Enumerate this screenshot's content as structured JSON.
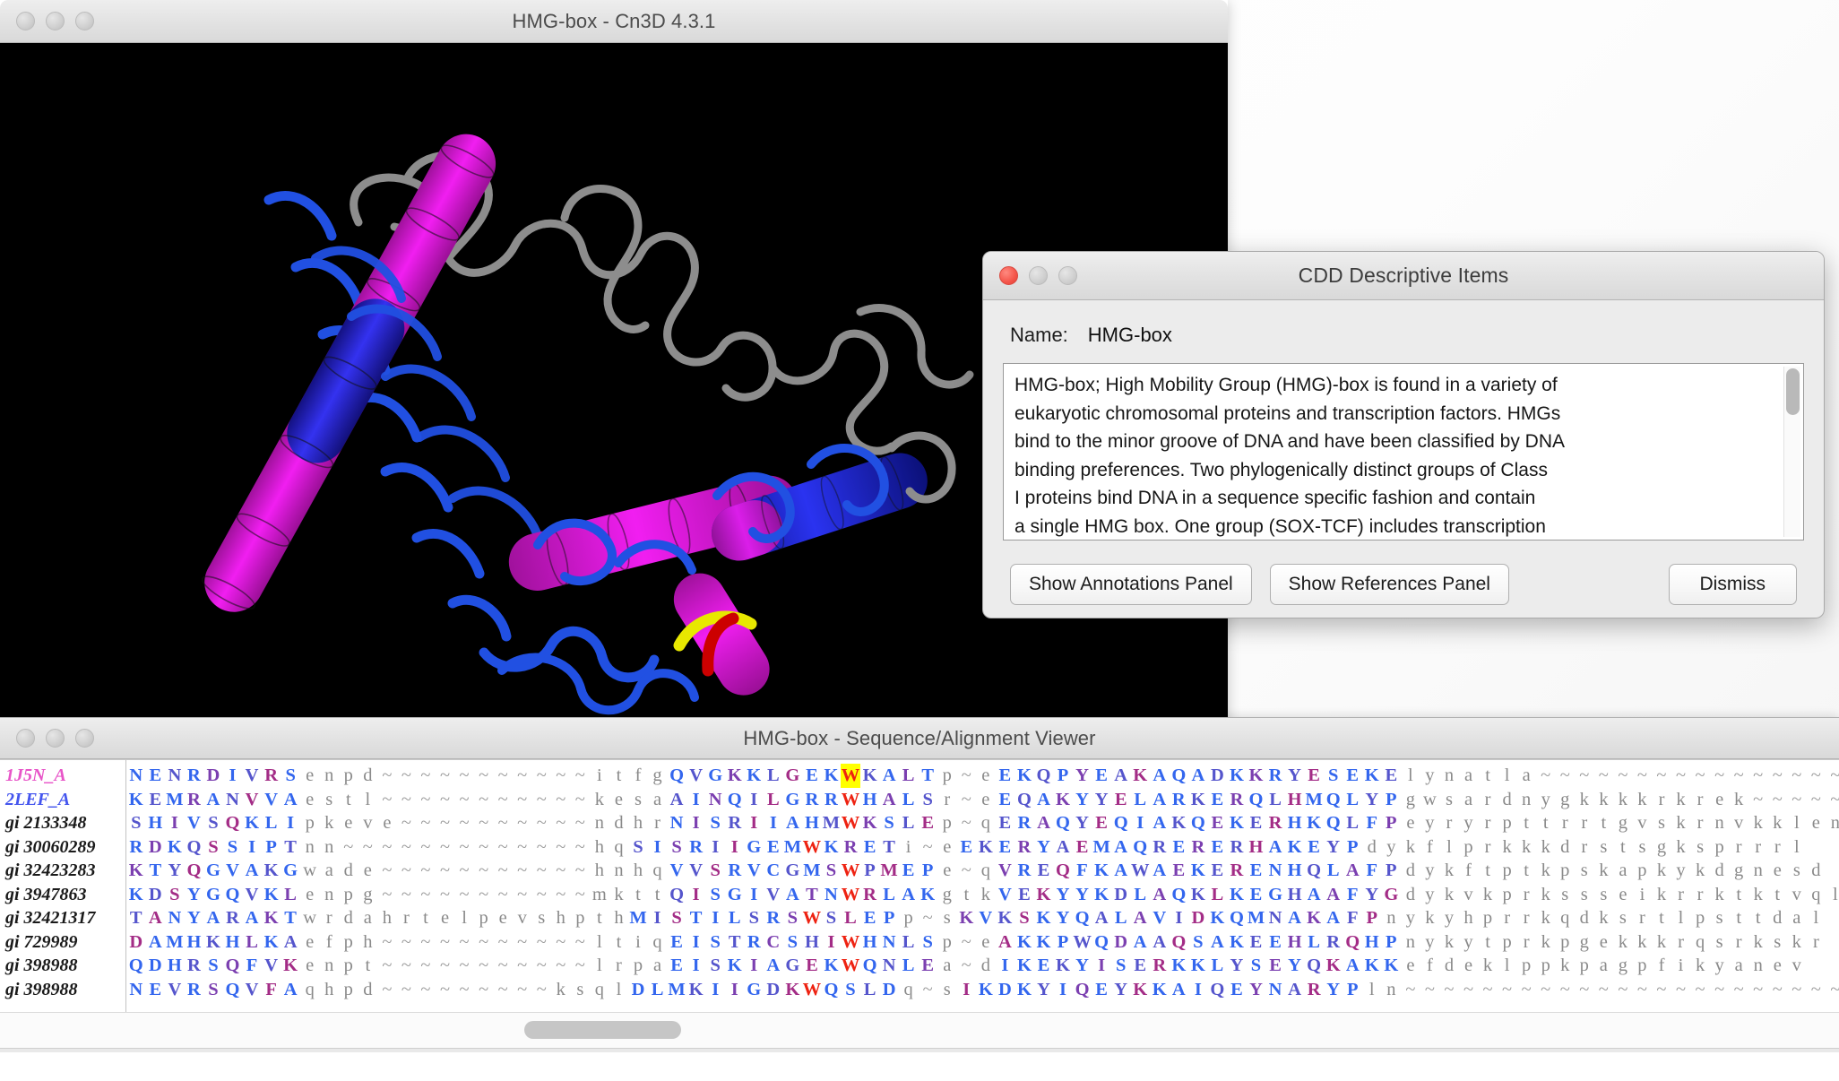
{
  "desktop": {
    "background_color": "#ffffff"
  },
  "main_window": {
    "title": "HMG-box - Cn3D 4.3.1",
    "traffic_lights": [
      "close-inactive",
      "minimize-inactive",
      "zoom-inactive"
    ],
    "viewport": {
      "background_color": "#000000",
      "render_style": "3D molecular structure ribbon/tube rendering",
      "colors": {
        "helix_a": "#e81ee8",
        "helix_b": "#1a2ae0",
        "coil": "#8a8a8a",
        "tube": "#2255dd",
        "highlight_yellow": "#e8e800",
        "highlight_red": "#cc0000"
      }
    }
  },
  "cdd_dialog": {
    "title": "CDD Descriptive Items",
    "traffic_lights": [
      "close-active",
      "minimize-inactive",
      "zoom-inactive"
    ],
    "name_label": "Name:",
    "name_value": "HMG-box",
    "description": "HMG-box; High Mobility Group (HMG)-box is found in a variety of\neukaryotic chromosomal proteins and transcription factors. HMGs\nbind to the minor groove of DNA and have been classified by DNA\nbinding preferences. Two phylogenically distinct groups of Class\nI proteins bind DNA in a sequence specific fashion and contain\na single HMG box. One group (SOX-TCF) includes transcription",
    "buttons": {
      "annotations": "Show Annotations Panel",
      "references": "Show References Panel",
      "dismiss": "Dismiss"
    }
  },
  "sequence_window": {
    "title": "HMG-box - Sequence/Alignment Viewer",
    "traffic_lights": [
      "close-inactive",
      "minimize-inactive",
      "zoom-inactive"
    ],
    "rows": [
      {
        "label": "1J5N_A",
        "label_color": "#e855c8",
        "segments": [
          {
            "text": "NENRDIVRS",
            "style": "u"
          },
          {
            "text": "enpd",
            "style": "l"
          },
          {
            "text": "~~~~~~~~~~~",
            "style": "gap"
          },
          {
            "text": "itfg",
            "style": "l"
          },
          {
            "text": "QVGKKLGEK",
            "style": "u"
          },
          {
            "text": "W",
            "style": "hl"
          },
          {
            "text": "KALT",
            "style": "u"
          },
          {
            "text": "p",
            "style": "l"
          },
          {
            "text": "~",
            "style": "gap"
          },
          {
            "text": "e",
            "style": "l"
          },
          {
            "text": "EKQPYEAKAQADKKRYESEKE",
            "style": "u"
          },
          {
            "text": "lynatla",
            "style": "l"
          },
          {
            "text": "~~~~~~~~~~~~~~~~~~",
            "style": "gap"
          }
        ]
      },
      {
        "label": "2LEF_A",
        "label_color": "#4455ee",
        "segments": [
          {
            "text": "KEMRANVVA",
            "style": "u"
          },
          {
            "text": "estl",
            "style": "l"
          },
          {
            "text": "~~~~~~~~~~~",
            "style": "gap"
          },
          {
            "text": "kesa",
            "style": "l"
          },
          {
            "text": "AINQILGRR",
            "style": "u"
          },
          {
            "text": "W",
            "style": "w"
          },
          {
            "text": "HALS",
            "style": "u"
          },
          {
            "text": "r",
            "style": "l"
          },
          {
            "text": "~",
            "style": "gap"
          },
          {
            "text": "e",
            "style": "l"
          },
          {
            "text": "EQAKYYELARKERQLHMQLYP",
            "style": "u"
          },
          {
            "text": "gwsardnygkkkkrkrek",
            "style": "l"
          },
          {
            "text": "~~~~~",
            "style": "gap"
          }
        ]
      },
      {
        "label": "gi 2133348",
        "label_color": "#1a1a1a",
        "segments": [
          {
            "text": "SHIVSQKLI",
            "style": "u"
          },
          {
            "text": "pkeve",
            "style": "l"
          },
          {
            "text": "~~~~~~~~~~",
            "style": "gap"
          },
          {
            "text": "ndhr",
            "style": "l"
          },
          {
            "text": "NISRIIAHM",
            "style": "u"
          },
          {
            "text": "W",
            "style": "w"
          },
          {
            "text": "KSLE",
            "style": "u"
          },
          {
            "text": "p",
            "style": "l"
          },
          {
            "text": "~",
            "style": "gap"
          },
          {
            "text": "q",
            "style": "l"
          },
          {
            "text": "ERAQYEQIAKQEKERHKQLFP",
            "style": "u"
          },
          {
            "text": "eyryrpttrrtgvskrnvkklen",
            "style": "l"
          }
        ]
      },
      {
        "label": "gi 30060289",
        "label_color": "#1a1a1a",
        "segments": [
          {
            "text": "RDKQSSIPT",
            "style": "u"
          },
          {
            "text": "nn",
            "style": "l"
          },
          {
            "text": "~~~~~~~~~~~~~",
            "style": "gap"
          },
          {
            "text": "hq",
            "style": "l"
          },
          {
            "text": "SISRIIGEM",
            "style": "u"
          },
          {
            "text": "W",
            "style": "w"
          },
          {
            "text": "KRET",
            "style": "u"
          },
          {
            "text": "i",
            "style": "l"
          },
          {
            "text": "~",
            "style": "gap"
          },
          {
            "text": "e",
            "style": "l"
          },
          {
            "text": "EKERYAEMAQRERERHAKEYP",
            "style": "u"
          },
          {
            "text": "dykflprkkkdrstsgksprrrl",
            "style": "l"
          }
        ]
      },
      {
        "label": "gi 32423283",
        "label_color": "#1a1a1a",
        "segments": [
          {
            "text": "KTYQGVAKG",
            "style": "u"
          },
          {
            "text": "wade",
            "style": "l"
          },
          {
            "text": "~~~~~~~~~~~",
            "style": "gap"
          },
          {
            "text": "hnhq",
            "style": "l"
          },
          {
            "text": "VVSRVCGMS",
            "style": "u"
          },
          {
            "text": "W",
            "style": "w"
          },
          {
            "text": "PMEP",
            "style": "u"
          },
          {
            "text": "e",
            "style": "l"
          },
          {
            "text": "~",
            "style": "gap"
          },
          {
            "text": "q",
            "style": "l"
          },
          {
            "text": "VREQFKAWAEKERENHQLAFP",
            "style": "u"
          },
          {
            "text": "dykftptkpskapkykdgnesd",
            "style": "l"
          }
        ]
      },
      {
        "label": "gi 3947863",
        "label_color": "#1a1a1a",
        "segments": [
          {
            "text": "KDSYGQVKL",
            "style": "u"
          },
          {
            "text": "enpg",
            "style": "l"
          },
          {
            "text": "~~~~~~~~~~~",
            "style": "gap"
          },
          {
            "text": "mktt",
            "style": "l"
          },
          {
            "text": "QISGIVATN",
            "style": "u"
          },
          {
            "text": "W",
            "style": "w"
          },
          {
            "text": "RLAK",
            "style": "u"
          },
          {
            "text": "gt",
            "style": "l"
          },
          {
            "text": "k",
            "style": "l"
          },
          {
            "text": "VEKYYKDLAQKLKEGHAAFYG",
            "style": "u"
          },
          {
            "text": "dykvkprkssseikrrktktvqle",
            "style": "l"
          }
        ]
      },
      {
        "label": "gi 32421317",
        "label_color": "#1a1a1a",
        "segments": [
          {
            "text": "TANYARAKT",
            "style": "u"
          },
          {
            "text": "wrdahrtelpevshpth",
            "style": "l"
          },
          {
            "text": "MISTILSRS",
            "style": "u"
          },
          {
            "text": "W",
            "style": "w"
          },
          {
            "text": "SLEP",
            "style": "u"
          },
          {
            "text": "p",
            "style": "l"
          },
          {
            "text": "~",
            "style": "gap"
          },
          {
            "text": "s",
            "style": "l"
          },
          {
            "text": "KVKSKYQALAVIDKQMNAKAFP",
            "style": "u"
          },
          {
            "text": "nykyhprrkqdksrtlpsttdal",
            "style": "l"
          }
        ]
      },
      {
        "label": "gi 729989",
        "label_color": "#1a1a1a",
        "segments": [
          {
            "text": "DAMHKHLKA",
            "style": "u"
          },
          {
            "text": "efph",
            "style": "l"
          },
          {
            "text": "~~~~~~~~~~~",
            "style": "gap"
          },
          {
            "text": "ltiq",
            "style": "l"
          },
          {
            "text": "EISTRCSHI",
            "style": "u"
          },
          {
            "text": "W",
            "style": "w"
          },
          {
            "text": "HNLS",
            "style": "u"
          },
          {
            "text": "p",
            "style": "l"
          },
          {
            "text": "~",
            "style": "gap"
          },
          {
            "text": "e",
            "style": "l"
          },
          {
            "text": "AKKPWQDAAQSAKEEHLRQHP",
            "style": "u"
          },
          {
            "text": "nykytprkpgekkkrqsrkskr",
            "style": "l"
          }
        ]
      },
      {
        "label": "gi 398988",
        "label_color": "#1a1a1a",
        "segments": [
          {
            "text": "QDHRSQFVK",
            "style": "u"
          },
          {
            "text": "enpt",
            "style": "l"
          },
          {
            "text": "~~~~~~~~~~~",
            "style": "gap"
          },
          {
            "text": "lrpa",
            "style": "l"
          },
          {
            "text": "EISKIAGEK",
            "style": "u"
          },
          {
            "text": "W",
            "style": "w"
          },
          {
            "text": "QNLE",
            "style": "u"
          },
          {
            "text": "a",
            "style": "l"
          },
          {
            "text": "~",
            "style": "gap"
          },
          {
            "text": "d",
            "style": "l"
          },
          {
            "text": "IKEKYISERKKLYSEYQKAKK",
            "style": "u"
          },
          {
            "text": "efdeklppkpagpfikyanev",
            "style": "l"
          }
        ]
      },
      {
        "label": "gi 398988",
        "label_color": "#1a1a1a",
        "segments": [
          {
            "text": "NEVRSQVFA",
            "style": "u"
          },
          {
            "text": "qhpd",
            "style": "l"
          },
          {
            "text": "~~~~~~~~~",
            "style": "gap"
          },
          {
            "text": "ksql",
            "style": "l"
          },
          {
            "text": "DLMKIIGDK",
            "style": "u"
          },
          {
            "text": "W",
            "style": "w"
          },
          {
            "text": "QSLD",
            "style": "u"
          },
          {
            "text": "q",
            "style": "l"
          },
          {
            "text": "~",
            "style": "gap"
          },
          {
            "text": "s",
            "style": "l"
          },
          {
            "text": "IKDKYIQEYKKAIQEYNARYP",
            "style": "u"
          },
          {
            "text": "ln",
            "style": "l"
          },
          {
            "text": "~~~~~~~~~~~~~~~~~~~~~~~",
            "style": "gap"
          }
        ]
      }
    ],
    "scrollbar": {
      "orientation": "horizontal",
      "thumb_position_pct": 33
    }
  }
}
